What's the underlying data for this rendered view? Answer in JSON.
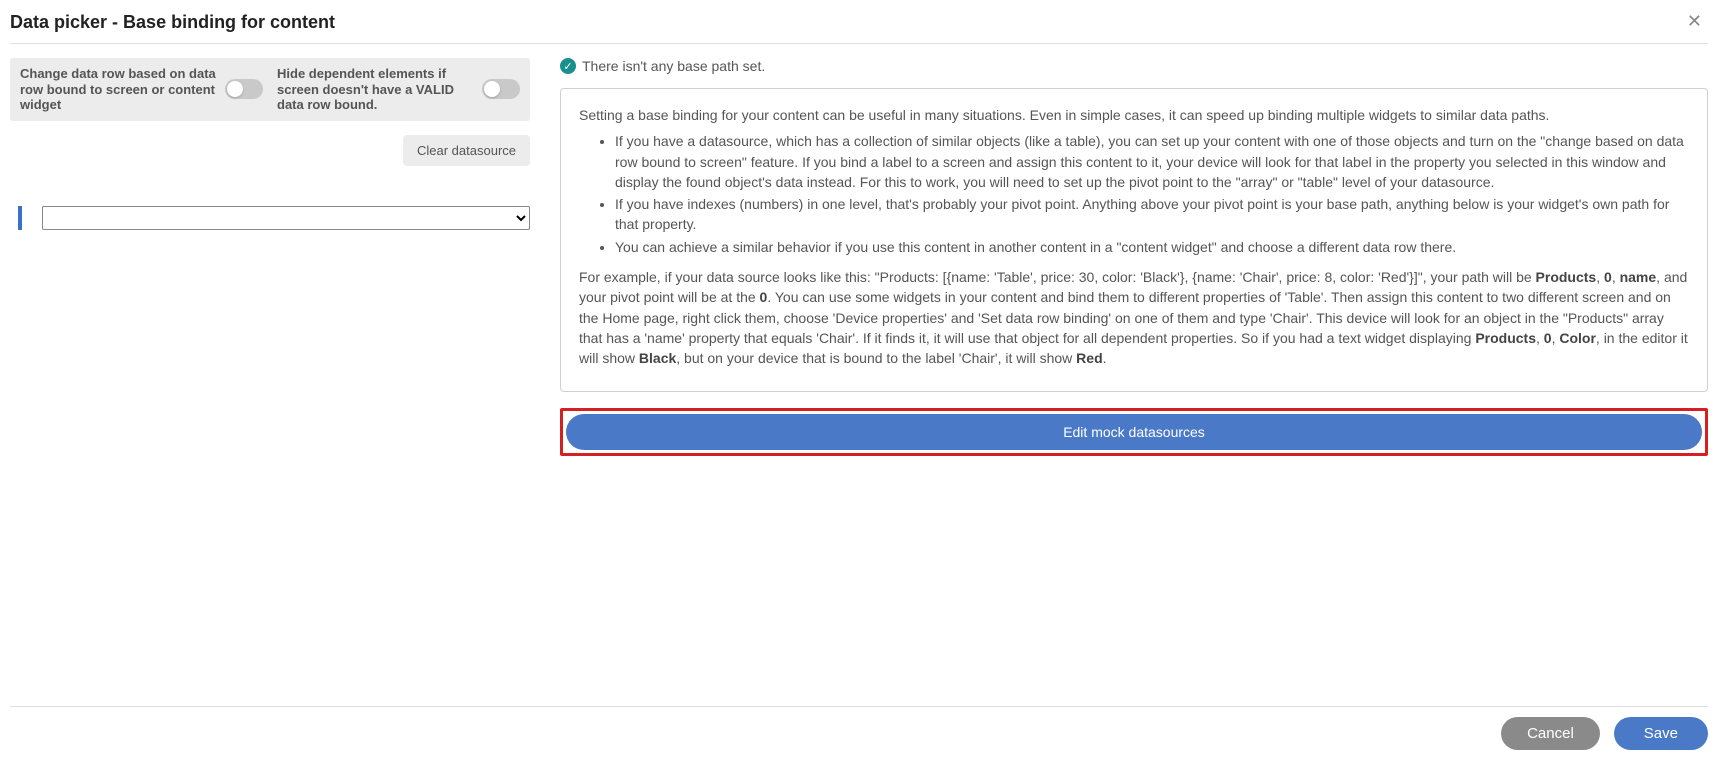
{
  "header": {
    "title": "Data picker - Base binding for content"
  },
  "left": {
    "toggle1_label": "Change data row based on data row bound to screen or content widget",
    "toggle2_label": "Hide dependent elements if screen doesn't have a VALID data row bound.",
    "clear_label": "Clear datasource"
  },
  "right": {
    "status_text": "There isn't any base path set.",
    "intro": "Setting a base binding for your content can be useful in many situations. Even in simple cases, it can speed up binding multiple widgets to similar data paths.",
    "bullet1": "If you have a datasource, which has a collection of similar objects (like a table), you can set up your content with one of those objects and turn on the \"change based on data row bound to screen\" feature. If you bind a label to a screen and assign this content to it, your device will look for that label in the property you selected in this window and display the found object's data instead. For this to work, you will need to set up the pivot point to the \"array\" or \"table\" level of your datasource.",
    "bullet2": "If you have indexes (numbers) in one level, that's probably your pivot point. Anything above your pivot point is your base path, anything below is your widget's own path for that property.",
    "bullet3": "You can achieve a similar behavior if you use this content in another content in a \"content widget\" and choose a different data row there.",
    "ex_t1": "For example, if your data source looks like this: \"Products: [{name: 'Table', price: 30, color: 'Black'}, {name: 'Chair', price: 8, color: 'Red'}]\", your path will be ",
    "ex_b1": "Products",
    "ex_t2": ", ",
    "ex_b2": "0",
    "ex_t3": ", ",
    "ex_b3": "name",
    "ex_t4": ", and your pivot point will be at the ",
    "ex_b4": "0",
    "ex_t5": ". You can use some widgets in your content and bind them to different properties of 'Table'. Then assign this content to two different screen and on the Home page, right click them, choose 'Device properties' and 'Set data row binding' on one of them and type 'Chair'. This device will look for an object in the \"Products\" array that has a 'name' property that equals 'Chair'. If it finds it, it will use that object for all dependent properties. So if you had a text widget displaying ",
    "ex_b5": "Products",
    "ex_t6": ", ",
    "ex_b6": "0",
    "ex_t7": ", ",
    "ex_b7": "Color",
    "ex_t8": ", in the editor it will show ",
    "ex_b8": "Black",
    "ex_t9": ", but on your device that is bound to the label 'Chair', it will show ",
    "ex_b9": "Red",
    "ex_t10": ".",
    "edit_mock_label": "Edit mock datasources"
  },
  "footer": {
    "cancel_label": "Cancel",
    "save_label": "Save"
  }
}
